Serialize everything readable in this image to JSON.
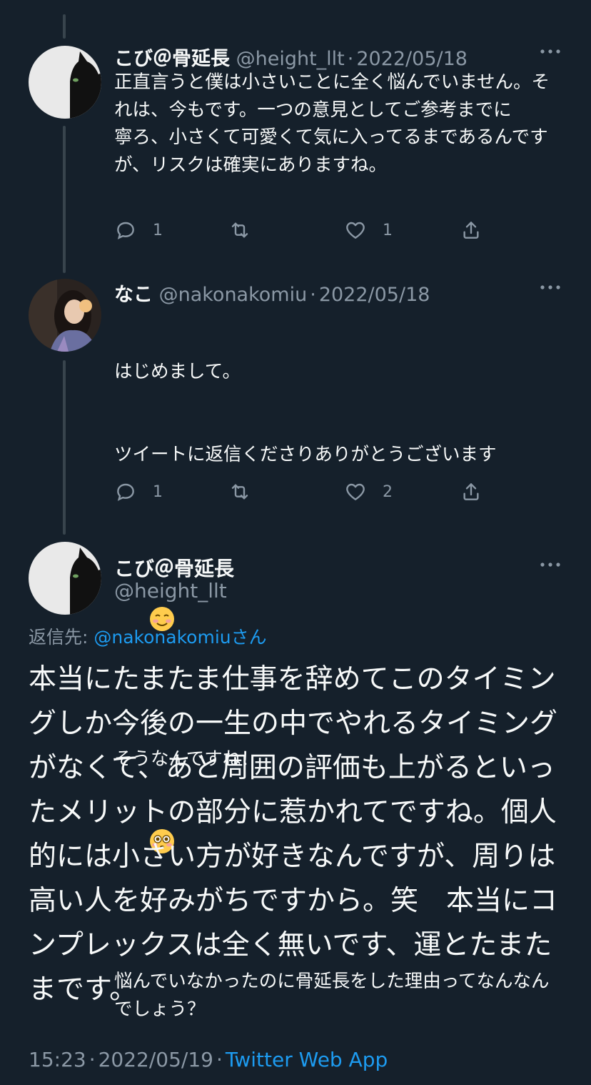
{
  "tweets": [
    {
      "name": "こび＠骨延長",
      "handle": "@height_llt",
      "sep": "·",
      "date": "2022/05/18",
      "text": "正直言うと僕は小さいことに全く悩んでいません。それは、今もです。一つの意見としてご参考までに\n寧ろ、小さくて可愛くて気に入ってるまであるんですが、リスクは確実にありますね。",
      "reply_count": "1",
      "retweet_count": "",
      "like_count": "1"
    },
    {
      "name": "なこ",
      "handle": "@nakonakomiu",
      "sep": "·",
      "date": "2022/05/18",
      "line1": "はじめまして。",
      "line2": "ツイートに返信くださりありがとうございます",
      "line3": "そうなんですね！",
      "line4": "悩んでいなかったのに骨延長をした理由ってなんなんでしょう？",
      "reply_count": "1",
      "retweet_count": "",
      "like_count": "2"
    }
  ],
  "main_tweet": {
    "name": "こび＠骨延長",
    "handle": "@height_llt",
    "reply_label": "返信先: ",
    "reply_handle": "@nakonakomiu",
    "reply_suffix": "さん",
    "text": "本当にたまたま仕事を辞めてこのタイミングしか今後の一生の中でやれるタイミングがなくて、あと周囲の評価も上がるといったメリットの部分に惹かれてですね。個人的には小さい方が好きなんですが、周りは高い人を好みがちですから。笑　本当にコンプレックスは全く無いです、運とたまたまです。",
    "time": "15:23",
    "sep": "·",
    "date": "2022/05/19",
    "source": "Twitter Web App"
  },
  "icons": {
    "reply": "reply-icon",
    "retweet": "retweet-icon",
    "like": "heart-icon",
    "share": "share-icon",
    "more": "more-icon",
    "emoji1": "smiling-face-icon",
    "emoji2": "flushed-face-icon"
  },
  "colors": {
    "background": "#15202b",
    "text": "#f7f9f9",
    "secondary": "#8b98a5",
    "accent": "#1d9bf0",
    "thread_line": "#38444d"
  }
}
